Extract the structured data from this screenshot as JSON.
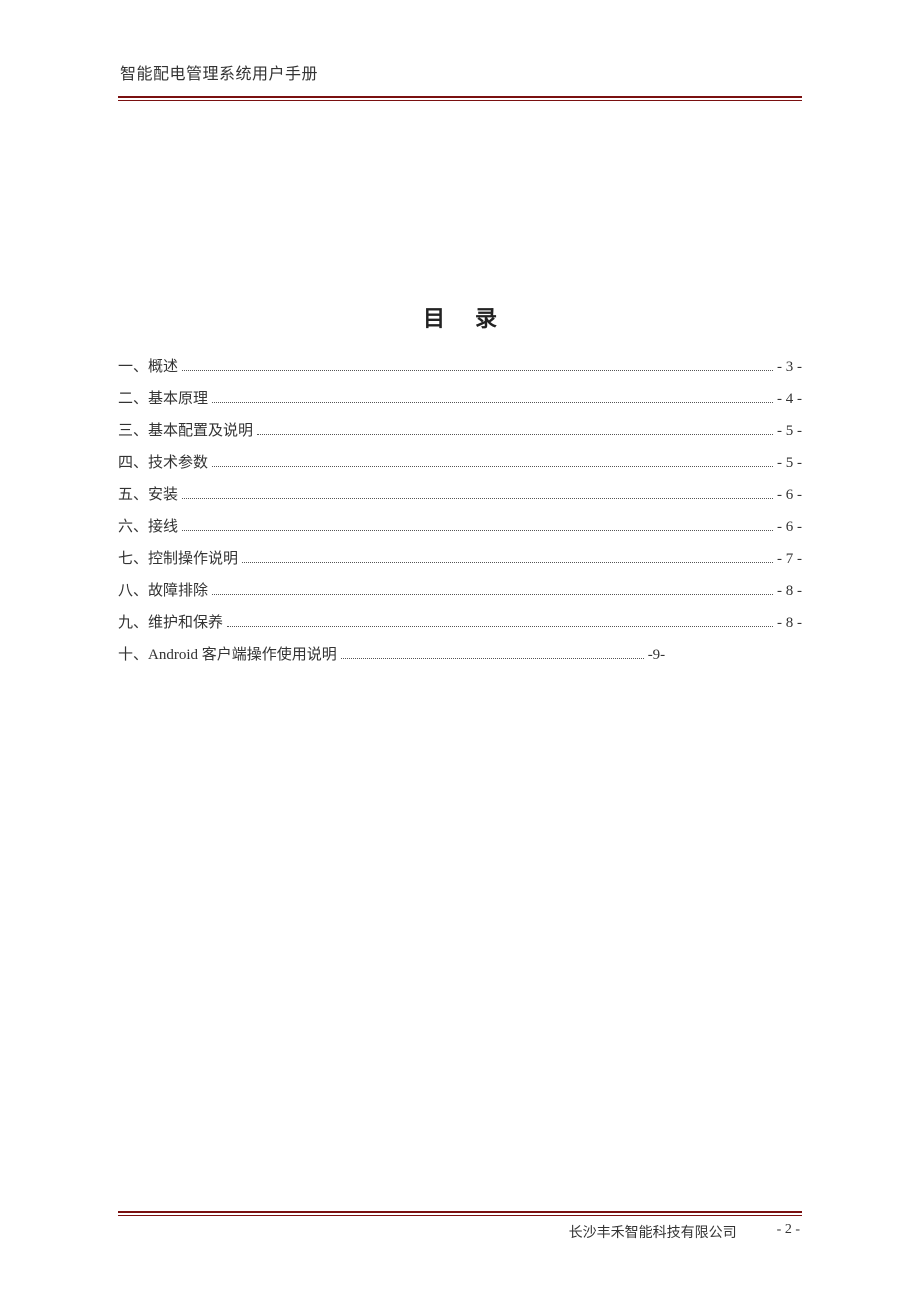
{
  "header": {
    "title": "智能配电管理系统用户手册"
  },
  "toc": {
    "title": "目录",
    "items": [
      {
        "label": "一、概述",
        "page": "- 3 -"
      },
      {
        "label": "二、基本原理",
        "page": "- 4 -"
      },
      {
        "label": "三、基本配置及说明",
        "page": "- 5 -"
      },
      {
        "label": "四、技术参数",
        "page": "- 5 -"
      },
      {
        "label": "五、安装",
        "page": "- 6 -"
      },
      {
        "label": "六、接线",
        "page": "- 6 -"
      },
      {
        "label": "七、控制操作说明",
        "page": "- 7 -"
      },
      {
        "label": "八、故障排除",
        "page": "- 8 -"
      },
      {
        "label": "九、维护和保养",
        "page": "- 8 -"
      },
      {
        "label": "十、Android 客户端操作使用说明",
        "page": "-9-"
      }
    ]
  },
  "footer": {
    "company": "长沙丰禾智能科技有限公司",
    "page_number": "- 2 -"
  }
}
